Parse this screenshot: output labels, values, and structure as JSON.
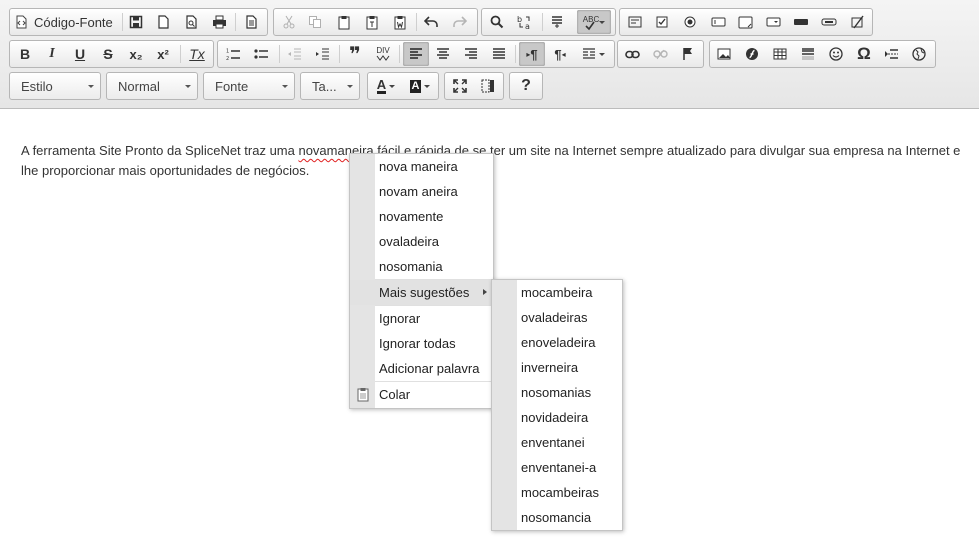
{
  "toolbar": {
    "source_label": "Código-Fonte",
    "style_combo": "Estilo",
    "format_combo": "Normal",
    "font_combo": "Fonte",
    "size_combo": "Ta...",
    "help_label": "?",
    "bold": "B",
    "italic": "I",
    "underline": "U",
    "strike": "S",
    "subscript": "x₂",
    "superscript": "x²",
    "remove_format": "Tx",
    "blockquote": "❞",
    "div_label": "DIV",
    "ltr": "¶",
    "rtl": "¶",
    "spellcheck_label": "ABC",
    "text_color_label": "A",
    "bg_color_label": "A",
    "special_char": "Ω"
  },
  "editor": {
    "text_before": "A ferramenta Site Pronto da SpliceNet traz uma ",
    "misspelled": "novamaneira",
    "text_after": " fácil e rápida de se ter um site na Internet sempre atualizado para divulgar sua empresa na Internet e lhe proporcionar mais oportunidades de negócios."
  },
  "context_menu": {
    "suggestions": [
      "nova maneira",
      "novam aneira",
      "novamente",
      "ovaladeira",
      "nosomania"
    ],
    "more": "Mais sugestões",
    "ignore": "Ignorar",
    "ignore_all": "Ignorar todas",
    "add_word": "Adicionar palavra",
    "paste": "Colar"
  },
  "submenu": {
    "items": [
      "mocambeira",
      "ovaladeiras",
      "enoveladeira",
      "inverneira",
      "nosomanias",
      "novidadeira",
      "enventanei",
      "enventanei-a",
      "mocambeiras",
      "nosomancia"
    ]
  }
}
